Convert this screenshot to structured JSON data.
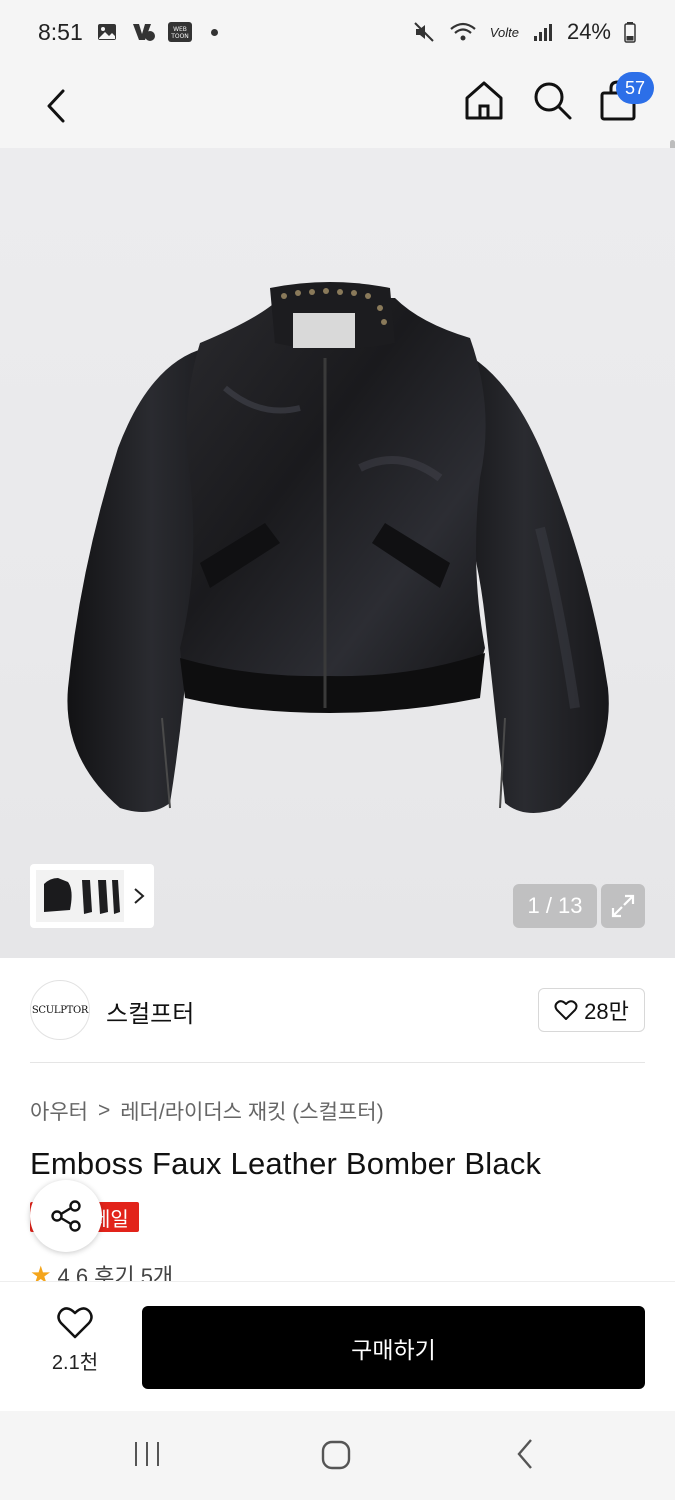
{
  "status_bar": {
    "time": "8:51",
    "app_badge": "WEB TOON",
    "lte_label": "Volte",
    "battery": "24%"
  },
  "nav": {
    "cart_count": "57"
  },
  "gallery": {
    "counter": "1 / 13"
  },
  "brand": {
    "logo_text": "SCULPTOR",
    "name": "스컬프터",
    "likes": "28만"
  },
  "breadcrumb": {
    "category": "아우터",
    "separator": ">",
    "subcategory": "레더/라이더스 재킷 (스컬프터)"
  },
  "product": {
    "title": "Emboss Faux Leather Bomber Black",
    "sale_badge": "세일",
    "rating": "4.6",
    "reviews": "후기 5개"
  },
  "bottom_bar": {
    "wish_count": "2.1천",
    "buy_label": "구매하기"
  },
  "colors": {
    "accent_blue": "#2c6fe8",
    "sale_red": "#e2231a",
    "star": "#f4a51c",
    "buy_button": "#000000"
  },
  "icons": [
    "back-icon",
    "home-icon",
    "search-icon",
    "cart-icon",
    "expand-icon",
    "heart-icon",
    "share-icon",
    "star-icon"
  ]
}
